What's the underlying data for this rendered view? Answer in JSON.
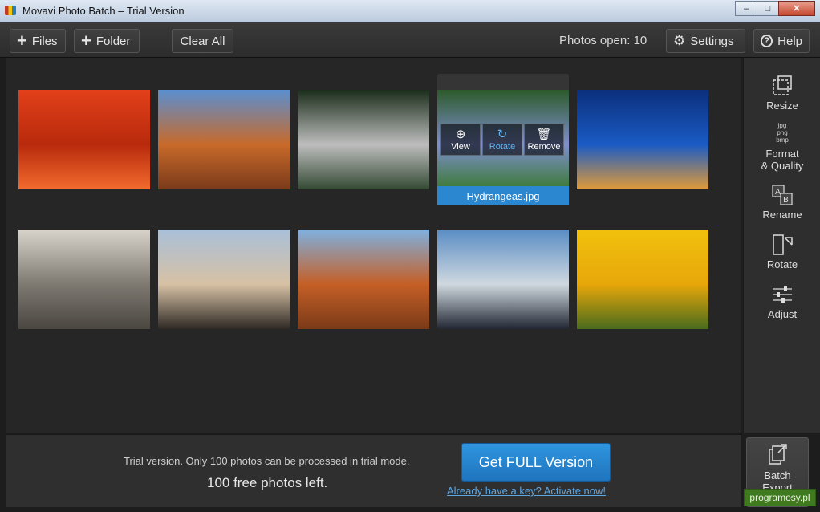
{
  "window": {
    "title": "Movavi Photo Batch – Trial Version",
    "minimize": "–",
    "maximize": "□",
    "close": "✕"
  },
  "toolbar": {
    "files_label": "Files",
    "folder_label": "Folder",
    "clear_all_label": "Clear All",
    "photos_open": "Photos open: 10",
    "settings_label": "Settings",
    "help_label": "Help",
    "help_glyph": "?"
  },
  "photos": [
    {
      "name": "chrysanthemum",
      "palette": [
        "#e2401a",
        "#b82a0c",
        "#f26b2d"
      ]
    },
    {
      "name": "desert",
      "palette": [
        "#5a8fd0",
        "#c86a2a",
        "#7a3a1a"
      ]
    },
    {
      "name": "hydrangea-bw",
      "palette": [
        "#1b2d1b",
        "#bdbdbd",
        "#344a34"
      ]
    },
    {
      "name": "hydrangeas",
      "palette": [
        "#2c5a2a",
        "#7f8fcf",
        "#3b7a33"
      ]
    },
    {
      "name": "jellyfish",
      "palette": [
        "#0b2f7c",
        "#1a5bc4",
        "#e09a38"
      ]
    },
    {
      "name": "koala",
      "palette": [
        "#d8d4cc",
        "#7e7a72",
        "#4a4640"
      ]
    },
    {
      "name": "lighthouse",
      "palette": [
        "#a9c0d8",
        "#d7c1a5",
        "#2f2a25"
      ]
    },
    {
      "name": "desert-2",
      "palette": [
        "#7fb0df",
        "#c55f26",
        "#7a3a17"
      ]
    },
    {
      "name": "penguins",
      "palette": [
        "#5a8dc5",
        "#cfd8df",
        "#222733"
      ]
    },
    {
      "name": "tulips",
      "palette": [
        "#f1c10d",
        "#e7a70a",
        "#4a6b1d"
      ]
    }
  ],
  "selected": {
    "caption": "Hydrangeas.jpg",
    "view_label": "View",
    "rotate_label": "Rotate",
    "remove_label": "Remove"
  },
  "tools": [
    {
      "label1": "Resize",
      "label2": "",
      "icon": "resize-icon"
    },
    {
      "label1": "Format",
      "label2": "& Quality",
      "icon": "format-icon",
      "formats": [
        "jpg",
        "png",
        "bmp"
      ]
    },
    {
      "label1": "Rename",
      "label2": "",
      "icon": "rename-icon"
    },
    {
      "label1": "Rotate",
      "label2": "",
      "icon": "rotate-icon"
    },
    {
      "label1": "Adjust",
      "label2": "",
      "icon": "adjust-icon"
    }
  ],
  "bottom": {
    "trial_text": "Trial version. Only 100 photos can be processed in trial mode.",
    "free_left": "100 free photos left.",
    "full_button": "Get FULL Version",
    "activate_link": "Already have a key? Activate now!",
    "batch_export_1": "Batch",
    "batch_export_2": "Export"
  },
  "watermark": "programosy.pl",
  "colors": {
    "accent": "#2a87d0",
    "link": "#5aa7e6"
  }
}
